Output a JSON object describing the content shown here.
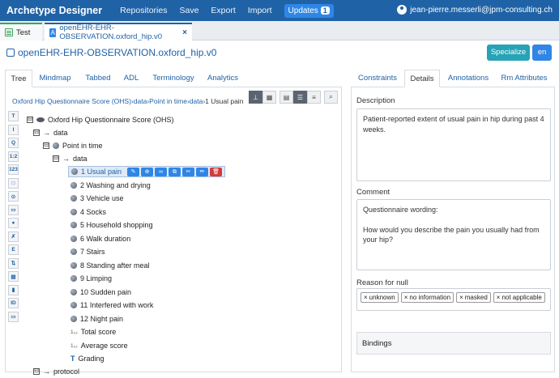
{
  "app": {
    "brand": "Archetype Designer",
    "menu": [
      "Repositories",
      "Save",
      "Export",
      "Import"
    ],
    "updates_label": "Updates",
    "updates_count": "1",
    "user": "jean-pierre.messerli@jpm-consulting.ch"
  },
  "file_tabs": {
    "test": "Test",
    "archetype": "openEHR-EHR-OBSERVATION.oxford_hip.v0",
    "close": "×"
  },
  "archetype": {
    "title": "openEHR-EHR-OBSERVATION.oxford_hip.v0",
    "specialize": "Specialize",
    "lang": "en"
  },
  "left_tabs": [
    "Tree",
    "Mindmap",
    "Tabbed",
    "ADL",
    "Terminology",
    "Analytics"
  ],
  "right_tabs": [
    "Constraints",
    "Details",
    "Annotations",
    "Rm Attributes"
  ],
  "breadcrumb": {
    "parts": [
      "Oxford Hip Questionnaire Score (OHS)",
      "data",
      "Point in time",
      "data"
    ],
    "current": "1 Usual pain",
    "sep": "›"
  },
  "sidebar_icons": [
    "T",
    "I",
    "Q",
    "1:2",
    "123",
    "□",
    "⊙",
    "▭",
    "●",
    "✗",
    "E",
    "⇅",
    "▤",
    "▮",
    "ID",
    "▭"
  ],
  "tree": [
    {
      "label": "Oxford Hip Questionnaire Score (OHS)",
      "toggle": "⊟",
      "icon": "eye"
    },
    {
      "label": "data",
      "toggle": "⊟",
      "icon": "arrow"
    },
    {
      "label": "Point in time",
      "toggle": "⊟",
      "icon": "ball"
    },
    {
      "label": "data",
      "toggle": "⊟",
      "icon": "arrow"
    },
    {
      "label": "1 Usual pain",
      "icon": "ball",
      "selected": true
    },
    {
      "label": "2 Washing and drying",
      "icon": "ball"
    },
    {
      "label": "3 Vehicle use",
      "icon": "ball"
    },
    {
      "label": "4 Socks",
      "icon": "ball"
    },
    {
      "label": "5 Household shopping",
      "icon": "ball"
    },
    {
      "label": "6 Walk duration",
      "icon": "ball"
    },
    {
      "label": "7 Stairs",
      "icon": "ball"
    },
    {
      "label": "8 Standing after meal",
      "icon": "ball"
    },
    {
      "label": "9 Limping",
      "icon": "ball"
    },
    {
      "label": "10 Sudden pain",
      "icon": "ball"
    },
    {
      "label": "11 Interfered with work",
      "icon": "ball"
    },
    {
      "label": "12 Night pain",
      "icon": "ball"
    },
    {
      "label": "Total score",
      "icon": "count"
    },
    {
      "label": "Average score",
      "icon": "count"
    },
    {
      "label": "Grading",
      "icon": "text"
    },
    {
      "label": "protocol",
      "toggle": "⊟",
      "icon": "arrow"
    }
  ],
  "details": {
    "description_label": "Description",
    "description": "Patient-reported extent of usual pain in hip during past 4 weeks.",
    "comment_label": "Comment",
    "comment_line1": "Questionnaire wording:",
    "comment_line2": "How would you describe the pain you usually had from your hip?",
    "null_label": "Reason for null",
    "null_reasons": [
      "unknown",
      "no information",
      "masked",
      "not applicable"
    ],
    "bindings_label": "Bindings"
  }
}
